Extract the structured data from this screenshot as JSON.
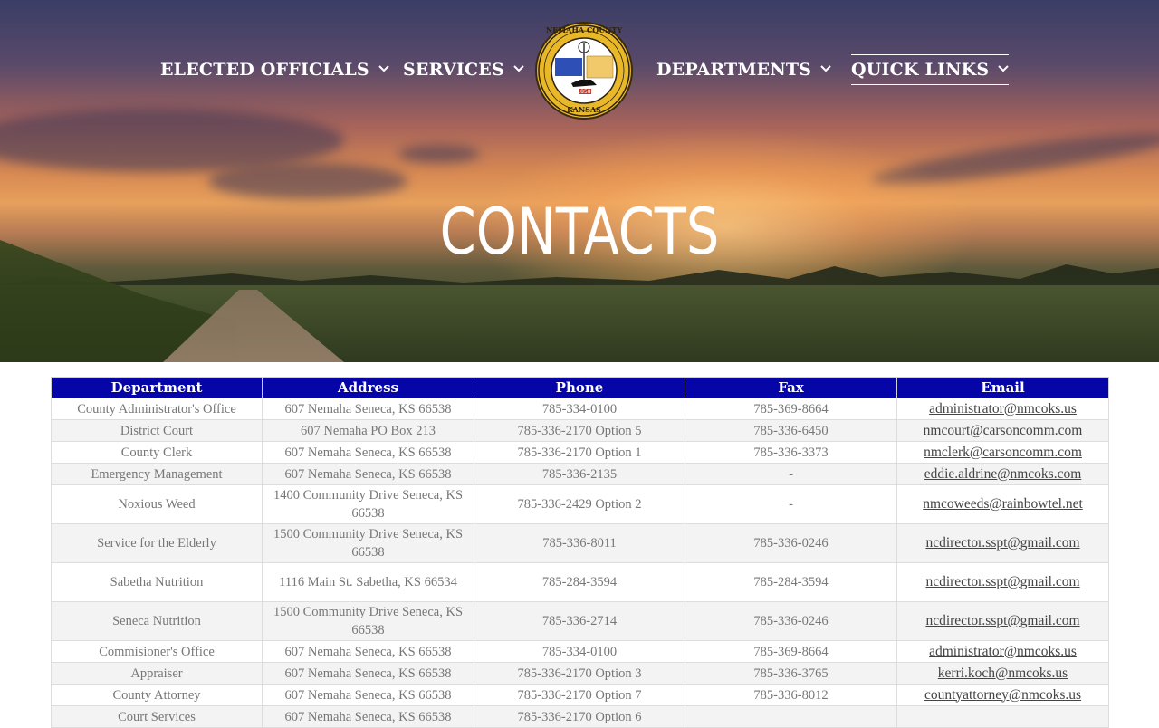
{
  "nav": {
    "items": [
      {
        "label": "ELECTED OFFICIALS"
      },
      {
        "label": "SERVICES"
      },
      {
        "label": "DEPARTMENTS"
      },
      {
        "label": "QUICK LINKS"
      }
    ],
    "seal_text_top": "NEMAHA COUNTY",
    "seal_text_bottom": "KANSAS",
    "seal_year": "1858"
  },
  "hero": {
    "title": "CONTACTS"
  },
  "table": {
    "headers": [
      "Department",
      "Address",
      "Phone",
      "Fax",
      "Email"
    ],
    "rows": [
      {
        "department": "County Administrator's Office",
        "address": "607 Nemaha Seneca, KS 66538",
        "phone": "785-334-0100",
        "fax": "785-369-8664",
        "email": "administrator@nmcoks.us"
      },
      {
        "department": "District Court",
        "address": "607 Nemaha PO Box 213",
        "phone": "785-336-2170 Option 5",
        "fax": "785-336-6450",
        "email": "nmcourt@carsoncomm.com"
      },
      {
        "department": "County Clerk",
        "address": "607 Nemaha Seneca, KS 66538",
        "phone": "785-336-2170 Option 1",
        "fax": "785-336-3373",
        "email": "nmclerk@carsoncomm.com"
      },
      {
        "department": "Emergency Management",
        "address": "607 Nemaha Seneca, KS 66538",
        "phone": "785-336-2135",
        "fax": "-",
        "email": "eddie.aldrine@nmcoks.com"
      },
      {
        "department": "Noxious Weed",
        "address": "1400 Community Drive Seneca, KS 66538",
        "phone": "785-336-2429 Option 2",
        "fax": "-",
        "email": "nmcoweeds@rainbowtel.net"
      },
      {
        "department": "Service for the Elderly",
        "address": "1500 Community Drive Seneca, KS 66538",
        "phone": "785-336-8011",
        "fax": "785-336-0246",
        "email": "ncdirector.sspt@gmail.com"
      },
      {
        "department": "Sabetha Nutrition",
        "address": "1116 Main St. Sabetha, KS 66534",
        "phone": "785-284-3594",
        "fax": "785-284-3594",
        "email": "ncdirector.sspt@gmail.com"
      },
      {
        "department": "Seneca Nutrition",
        "address": "1500 Community Drive Seneca, KS 66538",
        "phone": "785-336-2714",
        "fax": "785-336-0246",
        "email": "ncdirector.sspt@gmail.com"
      },
      {
        "department": "Commisioner's Office",
        "address": "607 Nemaha Seneca, KS 66538",
        "phone": "785-334-0100",
        "fax": "785-369-8664",
        "email": "administrator@nmcoks.us"
      },
      {
        "department": "Appraiser",
        "address": "607 Nemaha Seneca, KS 66538",
        "phone": "785-336-2170 Option 3",
        "fax": "785-336-3765",
        "email": "kerri.koch@nmcoks.us"
      },
      {
        "department": "County Attorney",
        "address": "607 Nemaha Seneca, KS 66538",
        "phone": "785-336-2170 Option 7",
        "fax": "785-336-8012",
        "email": "countyattorney@nmcoks.us"
      },
      {
        "department": "Court Services",
        "address": "607 Nemaha Seneca, KS 66538",
        "phone": "785-336-2170 Option 6",
        "fax": "",
        "email": ""
      }
    ]
  }
}
